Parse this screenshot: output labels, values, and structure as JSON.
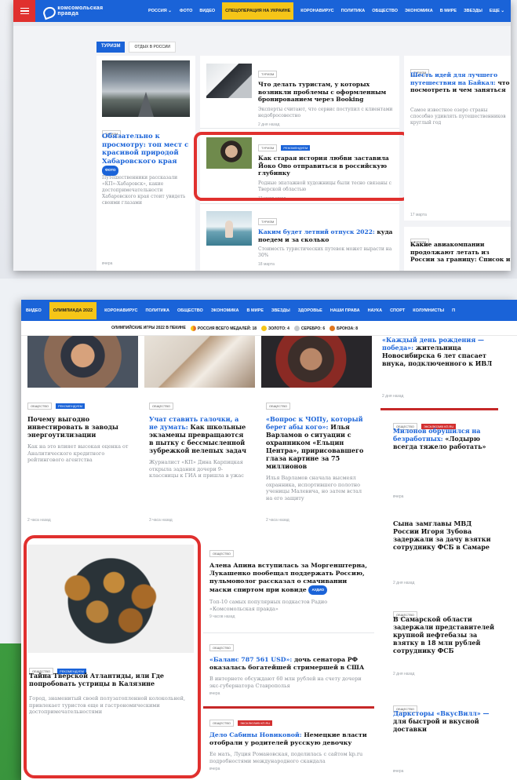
{
  "top": {
    "nav": {
      "logo_line1": "комсомольская",
      "logo_line2": "правда",
      "region": "РОССИЯ ⌄",
      "items": [
        "ФОТО",
        "ВИДЕО"
      ],
      "highlight": "СПЕЦОПЕРАЦИЯ НА УКРАИНЕ",
      "items2": [
        "КОРОНАВИРУС",
        "ПОЛИТИКА",
        "ОБЩЕСТВО",
        "ЭКОНОМИКА",
        "В МИРЕ",
        "ЗВЕЗДЫ"
      ],
      "more": "ЕЩЕ ⌄"
    },
    "section_tag": "ТУРИЗМ",
    "subsection_tag": "ОТДЫХ В РОССИИ",
    "card1": {
      "tag": "ТУРИЗМ",
      "title": "Обязательно к просмотру: топ мест с красивой природой Хабаровского края",
      "badge": "ФОТО",
      "lead": "Путешественники рассказали «КП»-Хабаровск», какие достопримечательности Хабаровского края стоит увидеть своими глазами",
      "time": "вчера"
    },
    "card2": {
      "tag": "ТУРИЗМ",
      "title": "Что делать туристам, у которых возникли проблемы с оформленным бронированием через Booking",
      "lead": "Эксперты считают, что сервис поступил с клиентами недобросовестно",
      "time": "2 дня назад"
    },
    "card3": {
      "tag1": "ТУРИЗМ",
      "tag2": "РЕКОМЕНДУЕМ",
      "title": "Как старая история любви заставила Йоко Оно отправиться в российскую глубинку",
      "lead": "Родные эпатажной художницы были тесно связаны с Тверской областью",
      "time": "12 часов назад"
    },
    "card4": {
      "tag": "ТУРИЗМ",
      "title_blue": "Каким будет летний отпуск 2022:",
      "title_rest": " куда поедем и за сколько",
      "lead": "Стоимость туристических путевок может вырасти на 30%",
      "time": "18 марта"
    },
    "card5": {
      "tag": "ТУРИЗМ",
      "title_blue": "Шесть идей для лучшего путешествия на Байкал:",
      "title_rest": " что посмотреть и чем заняться",
      "lead": "Самое известное озеро страны способно удивлять путешественников круглый год",
      "time": "17 марта"
    },
    "card6": {
      "tag": "ТУРИЗМ",
      "title": "Какие авиакомпании продолжают летать из России за границу: Список и"
    }
  },
  "bottom": {
    "nav": {
      "first": "ВИДЕО",
      "highlight": "ОЛИМПИАДА 2022",
      "items": [
        "КОРОНАВИРУС",
        "ПОЛИТИКА",
        "ОБЩЕСТВО",
        "ЭКОНОМИКА",
        "В МИРЕ",
        "ЗВЕЗДЫ",
        "ЗДОРОВЬЕ",
        "НАШИ ПРАВА",
        "НАУКА",
        "СПОРТ",
        "КОЛУМНИСТЫ",
        "П"
      ]
    },
    "olympic": {
      "label": "ОЛИМПИЙСКИЕ ИГРЫ 2022 В ПЕКИНЕ",
      "russia": "РОССИЯ ВСЕГО МЕДАЛЕЙ: 18",
      "gold": "ЗОЛОТО: 4",
      "silver": "СЕРЕБРО: 6",
      "bronze": "БРОНЗА: 8"
    },
    "col1": {
      "tag1": "ОБЩЕСТВО",
      "tag2": "РЕКОМЕНДУЕМ",
      "title": "Почему выгодно инвестировать в заводы энергоутилизации",
      "lead": "Как на это влияет высокая оценка от Аналитического кредитного рейтингового агентства",
      "time": "2 часа назад"
    },
    "col2": {
      "tag": "ОБЩЕСТВО",
      "title_blue": "Учат ставить галочки, а не думать:",
      "title_rest": " Как школьные экзамены превращаются в пытку с бессмысленной зубрежкой нелепых задач",
      "lead": "Журналист «КП» Дина Карпицкая открыла задания дочери 9-классницы к ГИА и пришла в ужас",
      "time": "3 часа назад"
    },
    "col3": {
      "tag": "ОБЩЕСТВО",
      "title_blue": "«Вопрос к ЧОПу, который берет абы кого»:",
      "title_rest": " Илья Варламов о ситуации с охранником «Ельцин Центра», пририсовавшего глаза картине за 75 миллионов",
      "lead": "Илья Варламов сначала высмеял охранника, испортившего полотно ученицы Малевича, но затем встал на его защиту",
      "time": "2 часа назад"
    },
    "right1": {
      "title_blue": "«Каждый день рождения — победа»:",
      "title_rest": " жительница Новосибирска 6 лет спасает внука, подключенного к ИВЛ",
      "time": "2 дня назад"
    },
    "right2": {
      "tag1": "ОБЩЕСТВО",
      "tag2": "ЭКСКЛЮЗИВ КП.RU",
      "title_blue": "Милонов обрушился на безработных:",
      "title_rest": " «Лодырю всегда тяжело работать»",
      "time": "вчера"
    },
    "right3": {
      "title": "Сына замглавы МВД России Игоря Зубова задержали за дачу взятки сотруднику ФСБ в Самаре",
      "time": "2 дня назад"
    },
    "right4": {
      "tag": "ОБЩЕСТВО",
      "title": "В Самарской области задержали представителей крупной нефтебазы за взятку в 18 млн рублей сотруднику ФСБ",
      "time": "2 дня назад"
    },
    "right5": {
      "tag": "ОБЩЕСТВО",
      "title_blue": "Даркстоpы «ВкусВилл» —",
      "title_rest": " для быстрой и вкусной доставки",
      "time": "вчера"
    },
    "snail": {
      "tag1": "ОБЩЕСТВО",
      "tag2": "РЕКОМЕНДУЕМ",
      "title": "Тайна Тверской Атлантиды, или Где попробовать устрицы в Калязине",
      "lead": "Город, знаменитый своей полузатопленной колокольней, привлекает туристов еще и гастрономическими достопримечательностями"
    },
    "mid1": {
      "tag": "ОБЩЕСТВО",
      "title": "Алена Апина вступилась за Моргенштерна, Лукашенко пообещал поддержать Россию, пульмонолог рассказал о смачивании маски спиртом при ковиде",
      "badge": "АУДИО",
      "lead": "Топ-10 самых популярных подкастов Радио «Комсомольская правда»",
      "time": "9 часов назад"
    },
    "mid2": {
      "tag": "ОБЩЕСТВО",
      "title_blue": "«Баланс 787 561 USD»:",
      "title_rest": " дочь сенатора РФ оказалась богатейшей стримершей в США",
      "lead": "В интернете обсуждают 60 млн рублей на счету дочери экс-губернатора Ставрополья",
      "time": "вчера"
    },
    "mid3": {
      "tag1": "ОБЩЕСТВО",
      "tag2": "ЭКСКЛЮЗИВ КП.RU",
      "title_blue": "Дело Сабины Новиковой:",
      "title_rest": " Немецкие власти отобрали у родителей русскую девочку",
      "lead": "Ее мать, Луция Романовская, поделилась с сайтом kp.ru подробностями международного скандала",
      "time": "вчера"
    }
  }
}
